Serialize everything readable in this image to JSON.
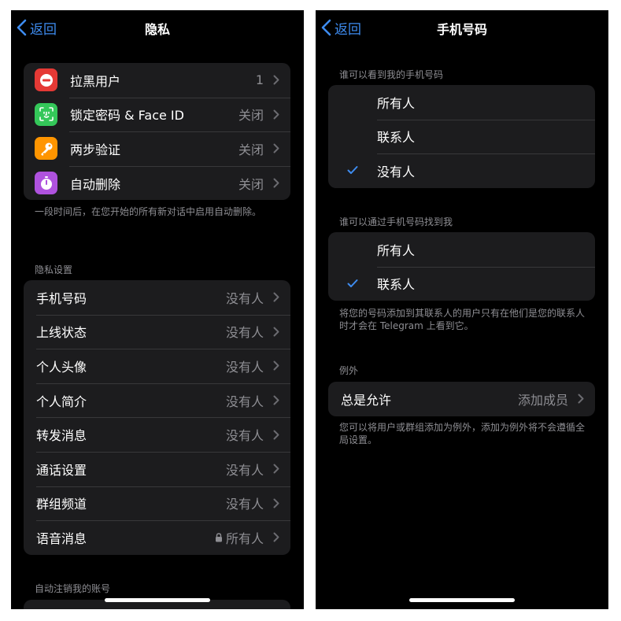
{
  "left": {
    "nav": {
      "back_label": "返回",
      "title": "隐私"
    },
    "top_group": [
      {
        "label": "拉黑用户",
        "value": "1",
        "icon": "block-icon",
        "color": "#e53935"
      },
      {
        "label": "锁定密码 & Face ID",
        "value": "关闭",
        "icon": "face-id-icon",
        "color": "#34c759"
      },
      {
        "label": "两步验证",
        "value": "关闭",
        "icon": "key-icon",
        "color": "#ff9500"
      },
      {
        "label": "自动删除",
        "value": "关闭",
        "icon": "timer-icon",
        "color": "#af52de"
      }
    ],
    "top_footer": "一段时间后，在您开始的所有新对话中启用自动删除。",
    "privacy_header": "隐私设置",
    "privacy_group": [
      {
        "label": "手机号码",
        "value": "没有人"
      },
      {
        "label": "上线状态",
        "value": "没有人"
      },
      {
        "label": "个人头像",
        "value": "没有人"
      },
      {
        "label": "个人简介",
        "value": "没有人"
      },
      {
        "label": "转发消息",
        "value": "没有人"
      },
      {
        "label": "通话设置",
        "value": "没有人"
      },
      {
        "label": "群组频道",
        "value": "没有人"
      },
      {
        "label": "语音消息",
        "value": "所有人",
        "locked": true
      }
    ],
    "auto_delete_header": "自动注销我的账号"
  },
  "right": {
    "nav": {
      "back_label": "返回",
      "title": "手机号码"
    },
    "see_header": "谁可以看到我的手机号码",
    "see_options": [
      {
        "label": "所有人",
        "selected": false
      },
      {
        "label": "联系人",
        "selected": false
      },
      {
        "label": "没有人",
        "selected": true
      }
    ],
    "find_header": "谁可以通过手机号码找到我",
    "find_options": [
      {
        "label": "所有人",
        "selected": false
      },
      {
        "label": "联系人",
        "selected": true
      }
    ],
    "find_footer": "将您的号码添加到其联系人的用户只有在他们是您的联系人时才会在 Telegram 上看到它。",
    "exceptions_header": "例外",
    "exceptions_row": {
      "label": "总是允许",
      "value": "添加成员"
    },
    "exceptions_footer": "您可以将用户或群组添加为例外，添加为例外将不会遵循全局设置。"
  },
  "colors": {
    "accent": "#3e8cf0",
    "cell_bg": "#1c1c1e",
    "secondary_text": "#8e8e93"
  }
}
